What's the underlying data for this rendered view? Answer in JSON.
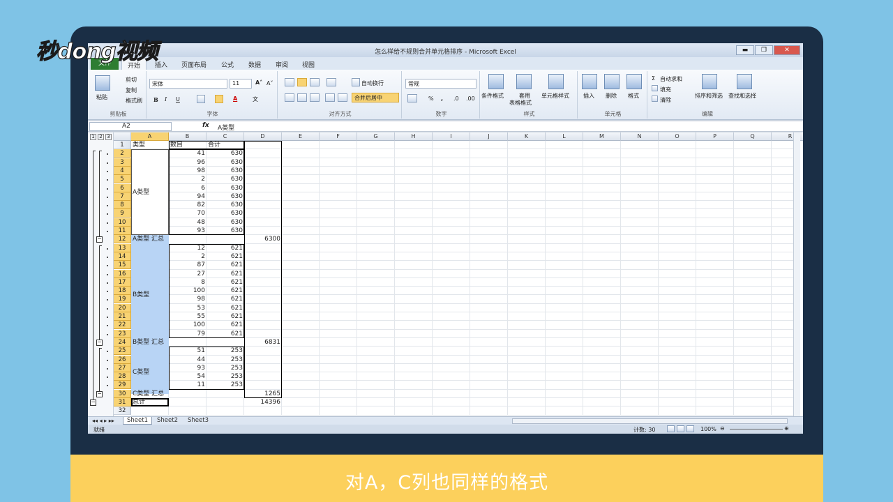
{
  "brand_logo": "秒dong视频",
  "caption": "对A，C列也同样的格式",
  "window": {
    "title": "怎么样给不规则合并单元格排序 - Microsoft Excel",
    "min": "▬",
    "max": "❐",
    "close": "✕"
  },
  "ribbon_tabs": [
    "文件",
    "开始",
    "插入",
    "页面布局",
    "公式",
    "数据",
    "审阅",
    "视图"
  ],
  "ribbon": {
    "clipboard": {
      "paste": "粘贴",
      "cut": "剪切",
      "copy": "复制",
      "format_painter": "格式刷",
      "group": "剪贴板"
    },
    "font": {
      "name": "宋体",
      "size": "11",
      "bold": "B",
      "italic": "I",
      "underline": "U",
      "group": "字体"
    },
    "align": {
      "wrap": "自动换行",
      "merge": "合并后居中",
      "group": "对齐方式"
    },
    "number": {
      "format": "常规",
      "percent": "%",
      "comma": ",",
      "group": "数字"
    },
    "styles": {
      "cond": "条件格式",
      "table1": "套用",
      "table2": "表格格式",
      "cell": "单元格样式",
      "group": "样式"
    },
    "cells": {
      "insert": "插入",
      "delete": "删除",
      "format": "格式",
      "group": "单元格"
    },
    "edit": {
      "autosum": "自动求和",
      "fill": "填充",
      "clear": "清除",
      "sort": "排序和筛选",
      "find": "查找和选择",
      "group": "编辑"
    }
  },
  "formula_bar": {
    "name_box": "A2",
    "fx": "fx",
    "value": "A类型"
  },
  "outline_levels": [
    "1",
    "2",
    "3"
  ],
  "columns": [
    "A",
    "B",
    "C",
    "D",
    "E",
    "F",
    "G",
    "H",
    "I",
    "J",
    "K",
    "L",
    "M",
    "N",
    "O",
    "P",
    "Q",
    "R"
  ],
  "headers": {
    "a": "类型",
    "b": "数目",
    "c": "合计"
  },
  "rows": [
    {
      "n": "1"
    },
    {
      "n": "2",
      "b": "41",
      "c": "630"
    },
    {
      "n": "3",
      "b": "96",
      "c": "630"
    },
    {
      "n": "4",
      "b": "98",
      "c": "630"
    },
    {
      "n": "5",
      "b": "2",
      "c": "630"
    },
    {
      "n": "6",
      "b": "6",
      "c": "630"
    },
    {
      "n": "7",
      "b": "94",
      "c": "630"
    },
    {
      "n": "8",
      "b": "82",
      "c": "630"
    },
    {
      "n": "9",
      "b": "70",
      "c": "630"
    },
    {
      "n": "10",
      "b": "48",
      "c": "630"
    },
    {
      "n": "11",
      "b": "93",
      "c": "630"
    },
    {
      "n": "12",
      "a": "A类型 汇总",
      "d": "6300"
    },
    {
      "n": "13",
      "b": "12",
      "c": "621"
    },
    {
      "n": "14",
      "b": "2",
      "c": "621"
    },
    {
      "n": "15",
      "b": "87",
      "c": "621"
    },
    {
      "n": "16",
      "b": "27",
      "c": "621"
    },
    {
      "n": "17",
      "b": "8",
      "c": "621"
    },
    {
      "n": "18",
      "b": "100",
      "c": "621"
    },
    {
      "n": "19",
      "b": "98",
      "c": "621"
    },
    {
      "n": "20",
      "b": "53",
      "c": "621"
    },
    {
      "n": "21",
      "b": "55",
      "c": "621"
    },
    {
      "n": "22",
      "b": "100",
      "c": "621"
    },
    {
      "n": "23",
      "b": "79",
      "c": "621"
    },
    {
      "n": "24",
      "a": "B类型 汇总",
      "d": "6831"
    },
    {
      "n": "25",
      "b": "51",
      "c": "253"
    },
    {
      "n": "26",
      "b": "44",
      "c": "253"
    },
    {
      "n": "27",
      "b": "93",
      "c": "253"
    },
    {
      "n": "28",
      "b": "54",
      "c": "253"
    },
    {
      "n": "29",
      "b": "11",
      "c": "253"
    },
    {
      "n": "30",
      "a": "C类型 汇总",
      "d": "1265"
    },
    {
      "n": "31",
      "a": "总计",
      "d": "14396"
    },
    {
      "n": "32"
    }
  ],
  "merged": {
    "a_group": "A类型",
    "b_group": "B类型",
    "c_group": "C类型"
  },
  "sheets": [
    "Sheet1",
    "Sheet2",
    "Sheet3"
  ],
  "status": {
    "ready": "就绪",
    "count": "计数: 30",
    "zoom": "100%"
  }
}
